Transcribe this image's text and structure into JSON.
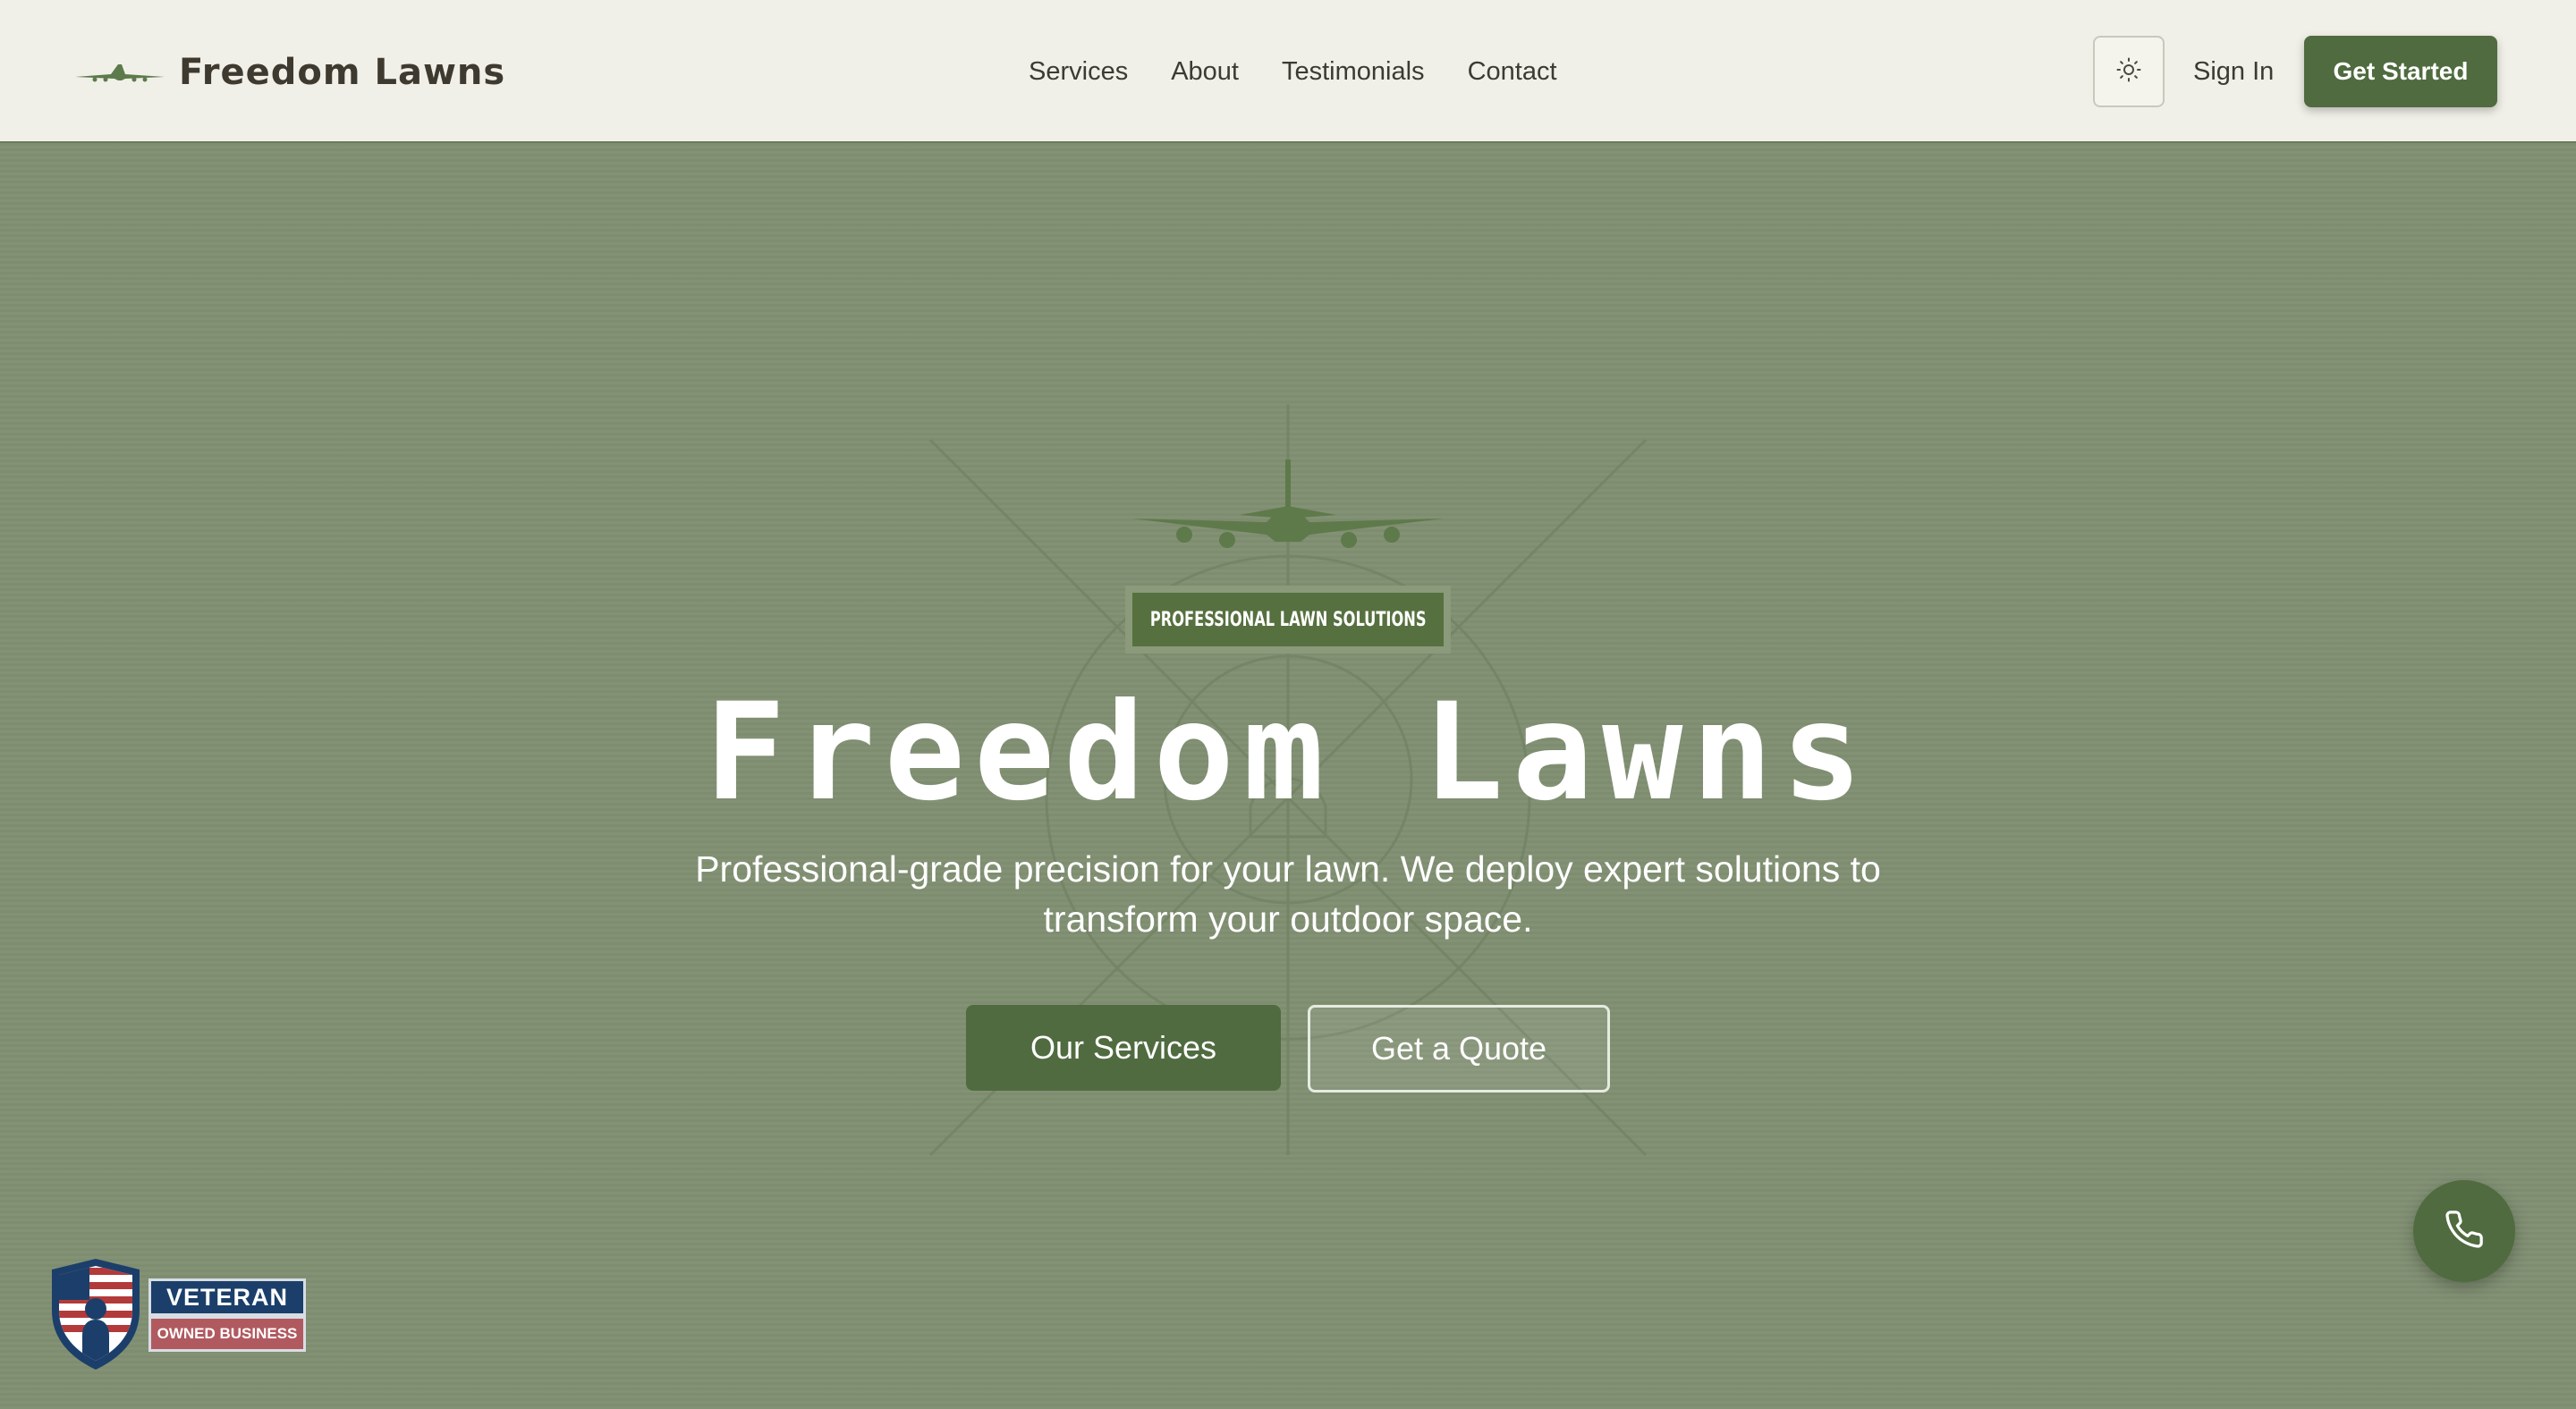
{
  "header": {
    "brand_name": "Freedom Lawns",
    "nav": [
      {
        "label": "Services"
      },
      {
        "label": "About"
      },
      {
        "label": "Testimonials"
      },
      {
        "label": "Contact"
      }
    ],
    "theme_toggle_icon": "sun-icon",
    "sign_in_label": "Sign In",
    "get_started_label": "Get Started"
  },
  "hero": {
    "badge": "PROFESSIONAL LAWN SOLUTIONS",
    "title": "Freedom Lawns",
    "subtitle_line1": "Professional-grade precision for your lawn. We deploy expert solutions to",
    "subtitle_line2": "transform your outdoor space.",
    "primary_button": "Our Services",
    "secondary_button": "Get a Quote"
  },
  "veteran_badge": {
    "top": "VETERAN",
    "bottom": "OWNED BUSINESS"
  },
  "floating": {
    "phone_icon": "phone-icon"
  },
  "colors": {
    "header_bg": "#f1f0e8",
    "hero_bg": "#808f72",
    "accent_green": "#4f6b3f",
    "brand_text": "#3e3a30"
  }
}
